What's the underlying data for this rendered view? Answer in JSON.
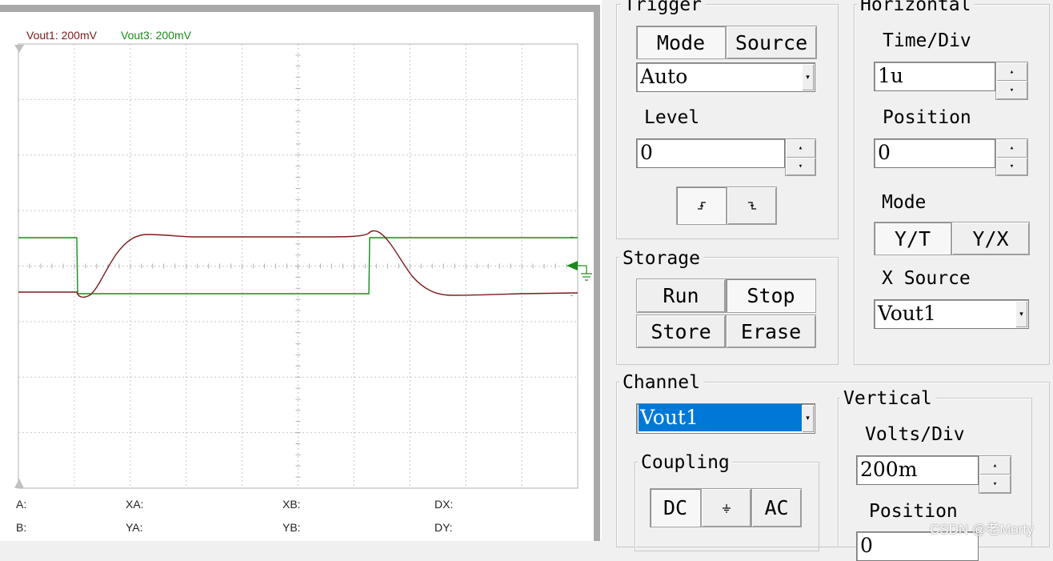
{
  "scope": {
    "traces": [
      {
        "label": "Vout1: 200mV",
        "color": "#7b1a1a"
      },
      {
        "label": "Vout3: 200mV",
        "color": "#1a8a1a"
      }
    ],
    "readouts": {
      "a": "A:",
      "xa": "XA:",
      "xb": "XB:",
      "dx": "DX:",
      "b": "B:",
      "ya": "YA:",
      "yb": "YB:",
      "dy": "DY:"
    },
    "grid_color": "#c8c8c8",
    "marker_color": "#1a8a1a"
  },
  "trigger": {
    "title": "Trigger",
    "mode_button": "Mode",
    "source_button": "Source",
    "mode_value": "Auto",
    "level_label": "Level",
    "level_value": "0",
    "edge_rising_icon": "rising-edge-icon",
    "edge_falling_icon": "falling-edge-icon"
  },
  "horizontal": {
    "title": "Horizontal",
    "time_div_label": "Time/Div",
    "time_div_value": "1u",
    "position_label": "Position",
    "position_value": "0",
    "mode_label": "Mode",
    "yt_button": "Y/T",
    "yx_button": "Y/X",
    "x_source_label": "X Source",
    "x_source_value": "Vout1"
  },
  "storage": {
    "title": "Storage",
    "run": "Run",
    "stop": "Stop",
    "store": "Store",
    "erase": "Erase"
  },
  "channel": {
    "title": "Channel",
    "selected": "Vout1",
    "coupling_title": "Coupling",
    "dc": "DC",
    "gnd_icon": "ground-icon",
    "ac": "AC"
  },
  "vertical": {
    "title": "Vertical",
    "volts_div_label": "Volts/Div",
    "volts_div_value": "200m",
    "position_label": "Position",
    "position_value": "0"
  },
  "watermark": "CSDN @老Morty"
}
